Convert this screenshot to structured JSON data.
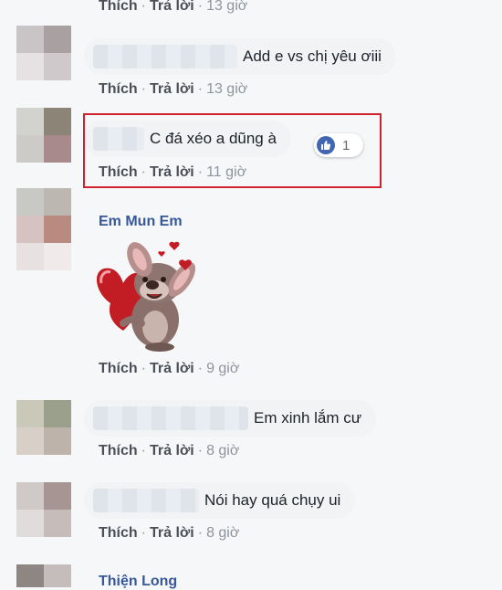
{
  "actions": {
    "like": "Thích",
    "reply": "Trả lời",
    "sep": "·"
  },
  "comments": [
    {
      "text": "",
      "time": "13 giờ"
    },
    {
      "text": "Add e vs chị yêu ơiii",
      "time": "13 giờ"
    },
    {
      "text": "C đá xéo a dũng à",
      "time": "11 giờ",
      "reactions": "1"
    },
    {
      "author": "Em Mun Em",
      "time": "9 giờ"
    },
    {
      "text": "Em xinh lắm cư",
      "time": "8 giờ"
    },
    {
      "text": "Nói hay quá chụy ui",
      "time": "8 giờ"
    },
    {
      "author": "Thiện Long"
    }
  ],
  "colors": {
    "highlight": "#d0212f",
    "link": "#365899",
    "like": "#4267b2"
  },
  "icons": {
    "reaction": "like-thumb-icon",
    "sticker": "mouse-heart-sticker"
  }
}
